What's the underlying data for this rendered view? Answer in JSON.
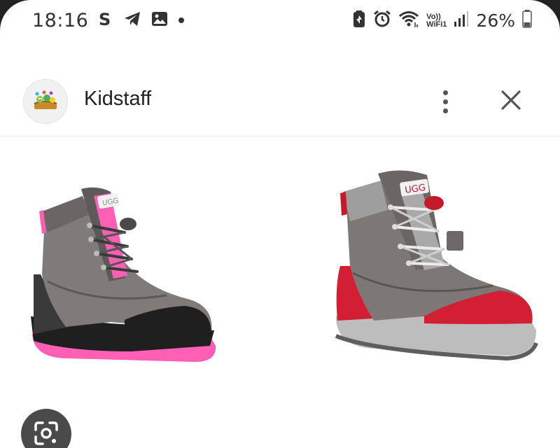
{
  "status_bar": {
    "time": "18:16",
    "notification_icons": [
      "skype-icon",
      "telegram-icon",
      "gallery-icon",
      "dot-icon"
    ],
    "system_icons": [
      "battery-saver-icon",
      "alarm-icon",
      "wifi-icon",
      "vowifi-icon",
      "signal-icon",
      "battery-icon"
    ],
    "vowifi_top": "Vo))",
    "vowifi_bottom": "WiFi1",
    "battery_percent": "26%"
  },
  "header": {
    "app_name": "Kidstaff",
    "menu_icon": "more-vert-icon",
    "close_icon": "close-icon"
  },
  "content": {
    "image_description_icons": [
      "boot-left-pink",
      "boot-right-red"
    ],
    "brand_label": "UGG"
  },
  "lens_button": {
    "icon": "google-lens-icon"
  },
  "colors": {
    "background": "#ffffff",
    "text": "#222222",
    "boot_gray": "#7a7674",
    "accent_pink": "#ff5fb4",
    "accent_red": "#d21f33"
  }
}
